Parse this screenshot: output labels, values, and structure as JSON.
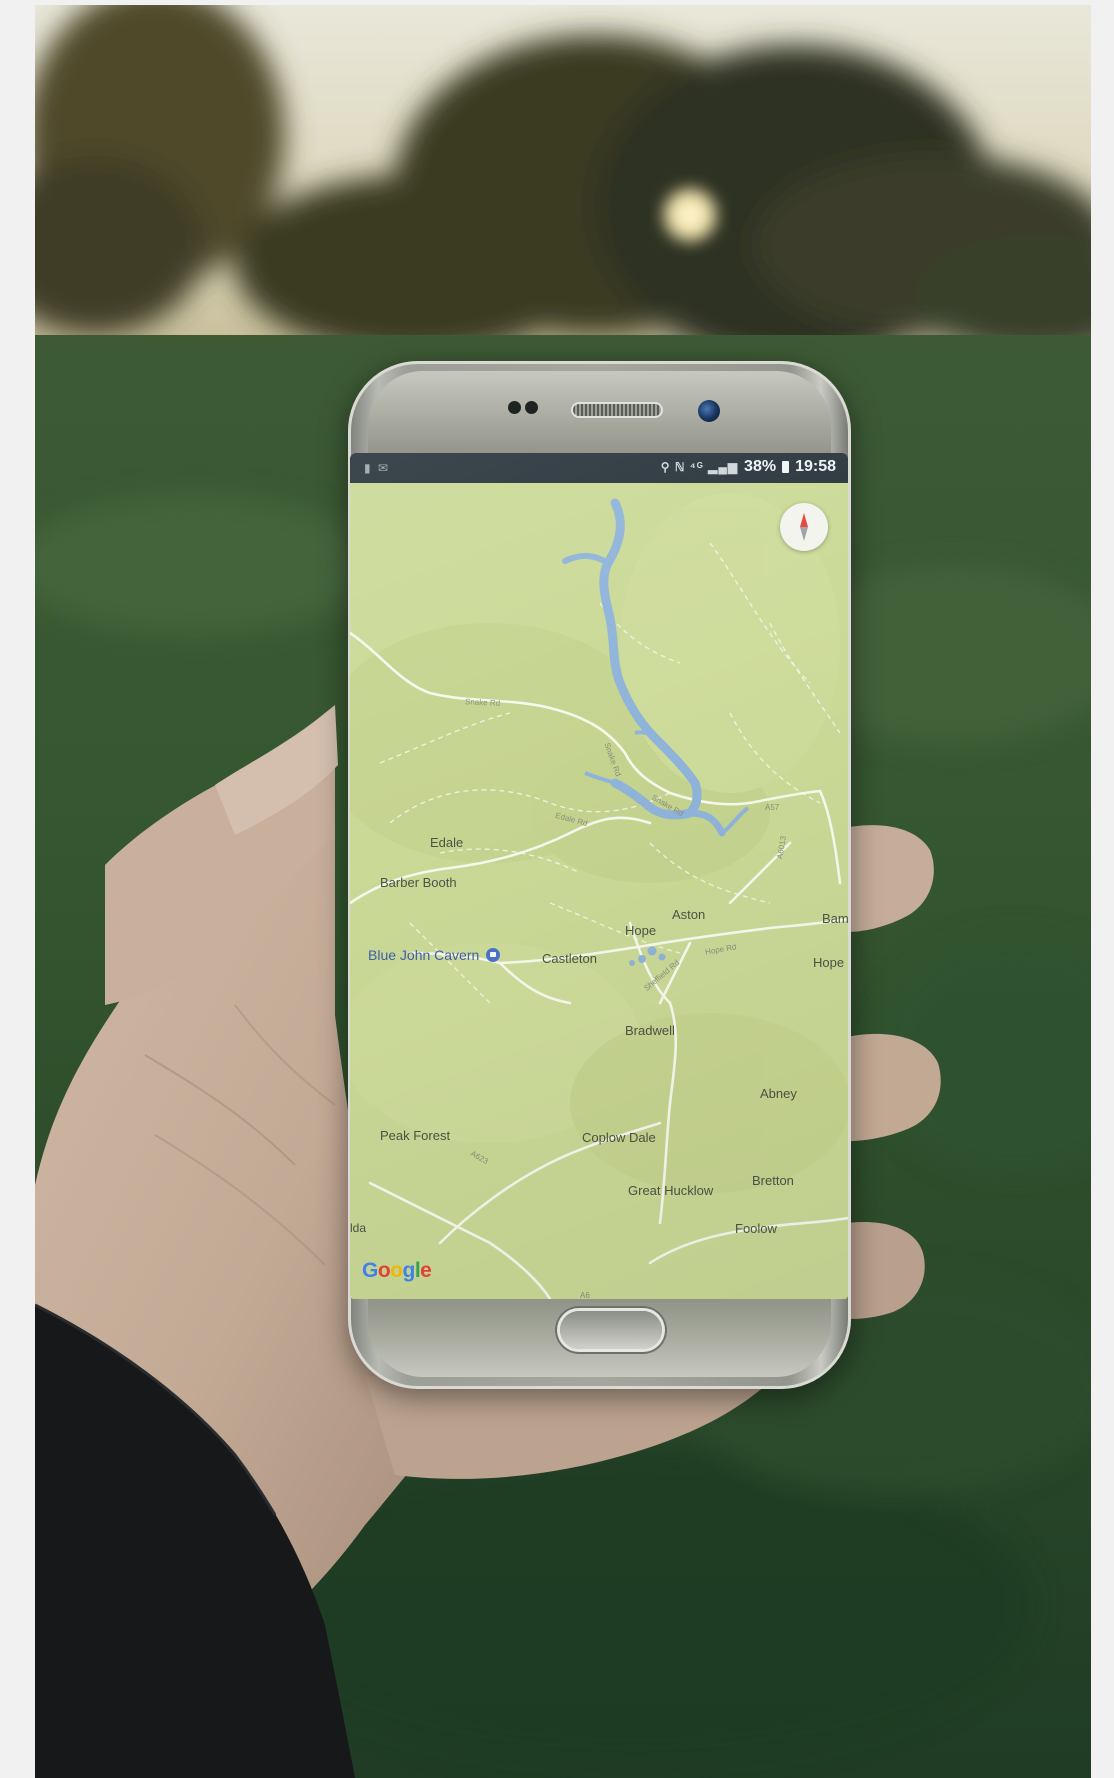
{
  "status_bar": {
    "left_icons": "▮ ✉",
    "signal_icons": "⚲ ℕ ⁴ᴳ ▂▄▆",
    "battery": "38%",
    "time": "19:58"
  },
  "map": {
    "places": [
      {
        "id": "edale",
        "label": "Edale"
      },
      {
        "id": "barber-booth",
        "label": "Barber Booth"
      },
      {
        "id": "blue-john-cavern",
        "label": "Blue John Cavern"
      },
      {
        "id": "castleton",
        "label": "Castleton"
      },
      {
        "id": "hope",
        "label": "Hope"
      },
      {
        "id": "aston",
        "label": "Aston"
      },
      {
        "id": "bradwell",
        "label": "Bradwell"
      },
      {
        "id": "abney",
        "label": "Abney"
      },
      {
        "id": "peak-forest",
        "label": "Peak Forest"
      },
      {
        "id": "coplow-dale",
        "label": "Coplow Dale"
      },
      {
        "id": "great-hucklow",
        "label": "Great Hucklow"
      },
      {
        "id": "bretton",
        "label": "Bretton"
      },
      {
        "id": "foolow",
        "label": "Foolow"
      },
      {
        "id": "bam",
        "label": "Bam"
      },
      {
        "id": "hope-east",
        "label": "Hope"
      }
    ],
    "roads": [
      {
        "id": "snake-rd-1",
        "label": "Snake Rd"
      },
      {
        "id": "snake-rd-2",
        "label": "Snake Rd"
      },
      {
        "id": "snake-rd-3",
        "label": "Snake Rd"
      },
      {
        "id": "edale-rd",
        "label": "Edale Rd"
      },
      {
        "id": "hope-rd",
        "label": "Hope Rd"
      },
      {
        "id": "sheffield-rd",
        "label": "Sheffield Rd"
      },
      {
        "id": "a623",
        "label": "A623"
      },
      {
        "id": "a57",
        "label": "A57"
      },
      {
        "id": "a6013",
        "label": "A6013"
      },
      {
        "id": "a6",
        "label": "A6"
      }
    ],
    "edge_fragment": "lda",
    "water_color": "#8fb3d9",
    "land_color": "#cad996",
    "poi_color": "#4a74c9"
  },
  "branding": {
    "google": [
      "G",
      "o",
      "o",
      "g",
      "l",
      "e"
    ]
  },
  "icons": {
    "compass": "compass-icon",
    "poi": "cave-poi-icon"
  }
}
